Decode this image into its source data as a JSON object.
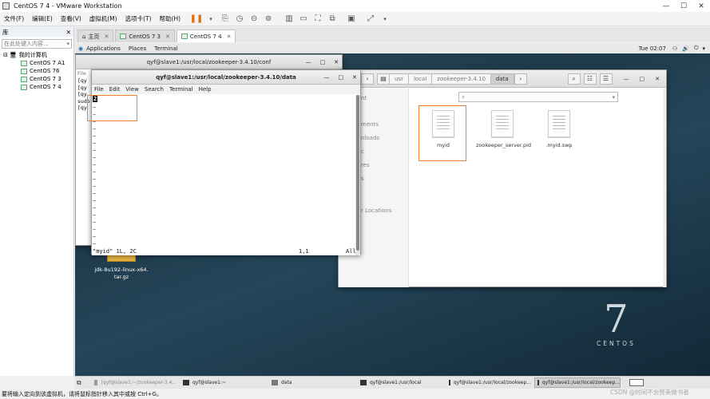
{
  "window": {
    "title": "CentOS 7 4 - VMware Workstation"
  },
  "menu": [
    "文件(F)",
    "编辑(E)",
    "查看(V)",
    "虚拟机(M)",
    "选项卡(T)",
    "帮助(H)"
  ],
  "library": {
    "title": "库",
    "search_placeholder": "在此处键入内容...",
    "root": "我的计算机",
    "vms": [
      "CentOS 7 A1",
      "CentOS 76",
      "CentOS 7 3",
      "CentOS 7 4"
    ]
  },
  "tabs": [
    {
      "label": "主页"
    },
    {
      "label": "CentOS 7 3"
    },
    {
      "label": "CentOS 7 4"
    }
  ],
  "gnome": {
    "applications": "Applications",
    "places": "Places",
    "terminal": "Terminal",
    "clock": "Tue 02:07"
  },
  "term_back": {
    "title": "qyf@slave1:/usr/local/zookeeper-3.4.10/conf",
    "file_menu": "File",
    "lines": [
      "[qy",
      "[qy",
      "[qy",
      "sudo",
      "[qy"
    ]
  },
  "term_front": {
    "title": "qyf@slave1:/usr/local/zookeeper-3.4.10/data",
    "menus": [
      "File",
      "Edit",
      "View",
      "Search",
      "Terminal",
      "Help"
    ],
    "cursor_char": "2",
    "status_left": "\"myid\" 1L, 2C",
    "status_pos": "1,1",
    "status_right": "All"
  },
  "files": {
    "breadcrumbs": [
      "usr",
      "local",
      "zookeeper-3.4.10",
      "data"
    ],
    "sidebar": [
      "nt",
      "ments",
      "nloads",
      "c",
      "res",
      "s",
      "r Locations"
    ],
    "items": [
      {
        "name": "myid"
      },
      {
        "name": "zookeeper_server.pid"
      },
      {
        "name": ".myid.swp"
      }
    ]
  },
  "desktop": {
    "icon_label_1": "jdk-8u192-linux-x64.",
    "icon_label_2": "tar.gz"
  },
  "centos": {
    "number": "7",
    "word": "CENTOS"
  },
  "taskbar": [
    "[qyf@slave1:~/zookeeper-3.4...",
    "qyf@slave1:~",
    "data",
    "qyf@slave1:/usr/local",
    "qyf@slave1:/usr/local/zookeep...",
    "qyf@slave1:/usr/local/zookeep..."
  ],
  "status": "要将输入定向到该虚拟机，请将鼠标指针移入其中或按 Ctrl+G。",
  "watermark": "CSDN @时间不会赞美做书者",
  "colors": {
    "highlight": "#f08030"
  }
}
